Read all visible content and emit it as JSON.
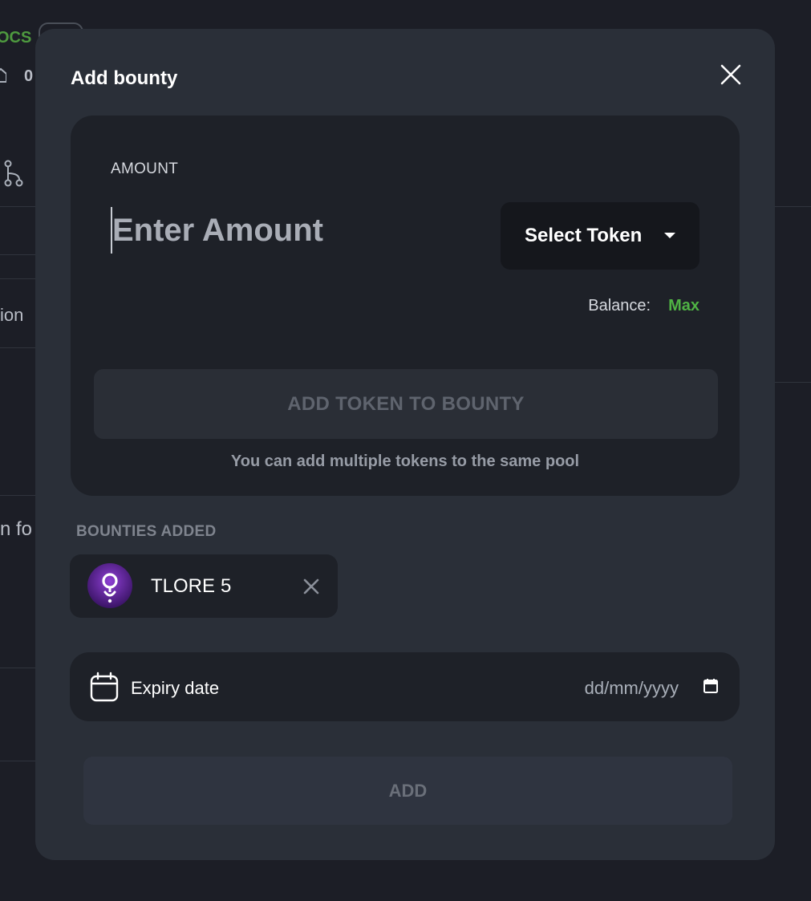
{
  "background": {
    "docs_label": "OCS",
    "count_label": "0",
    "partial_text_1": "ion",
    "partial_text_2": "n fo"
  },
  "modal": {
    "title": "Add bounty",
    "amount_section": {
      "label": "AMOUNT",
      "input_placeholder": "Enter Amount",
      "input_value": "",
      "select_token_label": "Select Token",
      "balance_label": "Balance:",
      "max_label": "Max",
      "add_token_button": "ADD TOKEN TO BOUNTY",
      "hint": "You can add multiple tokens to the same pool"
    },
    "bounties_section": {
      "label": "BOUNTIES ADDED",
      "items": [
        {
          "symbol": "TLORE",
          "amount": "5",
          "logo_icon": "tlore-logo-icon"
        }
      ]
    },
    "expiry": {
      "label": "Expiry date",
      "date_value": "dd/mm/yyyy"
    },
    "add_button": "ADD"
  },
  "colors": {
    "accent_green": "#4fb244",
    "modal_bg": "#2a2f38",
    "card_bg": "#1e2128",
    "token_purple": "#6a2ea8"
  }
}
